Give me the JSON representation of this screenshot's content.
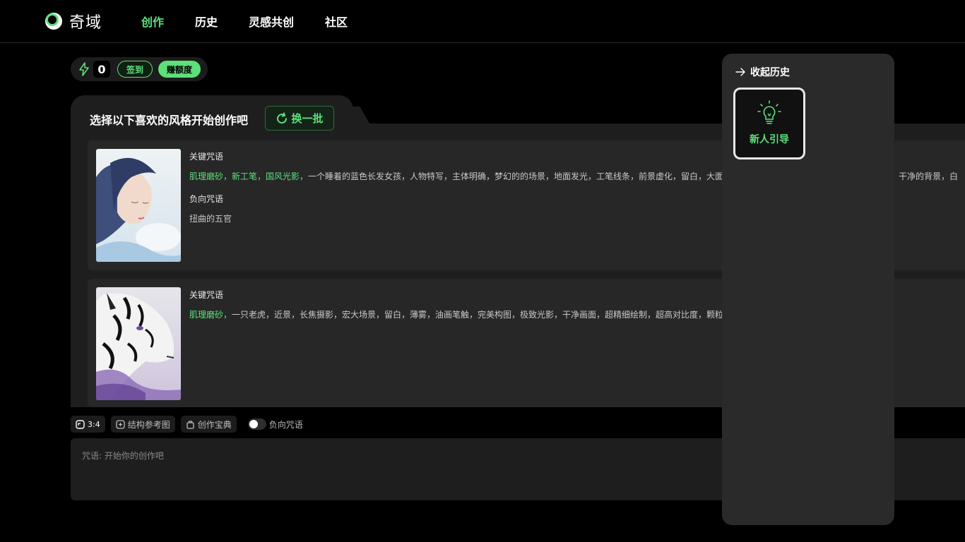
{
  "header": {
    "logo_text": "奇域",
    "nav": [
      {
        "label": "创作",
        "active": true
      },
      {
        "label": "历史",
        "active": false
      },
      {
        "label": "灵感共创",
        "active": false
      },
      {
        "label": "社区",
        "active": false
      }
    ]
  },
  "credits": {
    "icon": "bolt-icon",
    "count": "0",
    "signin_label": "签到",
    "earn_label": "赚额度"
  },
  "styles_panel": {
    "title": "选择以下喜欢的风格开始创作吧",
    "refresh_label": "换一批",
    "cards": [
      {
        "keyword_label": "关键咒语",
        "tags": "肌理磨砂，新工笔，国风光影，",
        "prompt": "一个睡着的蓝色长发女孩，人物特写，主体明确，梦幻的的场景，地面发光，工笔线条，前景虚化，留白，大面",
        "prompt_tail": "景，干净的背景，白",
        "negative_label": "负向咒语",
        "negative": "扭曲的五官"
      },
      {
        "keyword_label": "关键咒语",
        "tags": "肌理磨砂，",
        "prompt": "一只老虎，近景，长焦摄影，宏大场景，留白，薄雾，油画笔触，完美构图，极致光影，干净画面，超精细绘制，超高对比度，颗粒"
      }
    ]
  },
  "toolbar": {
    "ratio_label": "3:4",
    "structure_label": "结构参考图",
    "handbook_label": "创作宝典",
    "negative_toggle_label": "负向咒语",
    "negative_toggle_on": false
  },
  "prompt": {
    "placeholder": "咒语: 开始你的创作吧"
  },
  "history": {
    "collapse_label": "收起历史",
    "guide_label": "新人引导"
  },
  "colors": {
    "accent": "#5ce07a",
    "background": "#000000",
    "panel": "#1e1e1e"
  }
}
